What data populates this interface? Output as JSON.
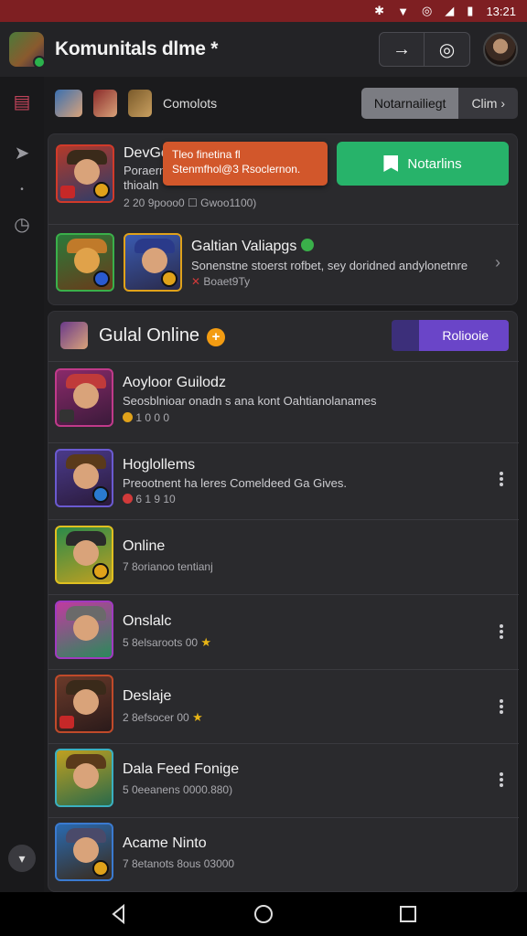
{
  "status_bar": {
    "time": "13:21"
  },
  "app_bar": {
    "title": "Komunitals dlme *",
    "btn_forward_icon": "→",
    "btn_chat_icon": "◎"
  },
  "filter_row": {
    "label": "Comolots",
    "active_button": "Notarnailiegt",
    "secondary_button": "Clim"
  },
  "card1": {
    "row1": {
      "title": "DevGo",
      "sub1": "Poraern",
      "sub2": "thioaln",
      "meta": "2 20 9pooo0 ☐ Gwoo1100)",
      "toast_line1": "Tleo finetina fl",
      "toast_line2": "Stenmfhol@3 Rsoclernon.",
      "button_label": "Notarlins"
    },
    "row2": {
      "title": "Galtian Valiapgs",
      "sub": "Sonenstne stoerst rofbet, sey doridned andylonetnre",
      "meta": "Boaet9Ty"
    }
  },
  "section": {
    "title": "Gulal Online",
    "button_label": "Roliooie"
  },
  "list": [
    {
      "title": "Aoyloor Guilodz",
      "sub": "Seosblnioar onadn s ana kont Oahtianolanames",
      "meta": "1 0 0 0"
    },
    {
      "title": "Hoglollems",
      "sub": "Preootnent ha leres Comeldeed Ga Gives.",
      "meta": "6 1 9 10"
    },
    {
      "title": "Online",
      "sub": "",
      "meta": "7 8orianoo   tentianj"
    },
    {
      "title": "Onslalc",
      "sub": "",
      "meta": "5 8elsaroots    00"
    },
    {
      "title": "Deslaje",
      "sub": "",
      "meta": "2 8efsocer    00"
    },
    {
      "title": "Dala Feed Fonige",
      "sub": "",
      "meta": "5 0eeanens    0000.880)"
    },
    {
      "title": "Acame Ninto",
      "sub": "",
      "meta": "7 8etanots    8ous 03000"
    }
  ],
  "colors": {
    "status_bar": "#7e1f22",
    "green": "#27b36a",
    "toast": "#d2572b",
    "purple": "#6a45c8"
  }
}
